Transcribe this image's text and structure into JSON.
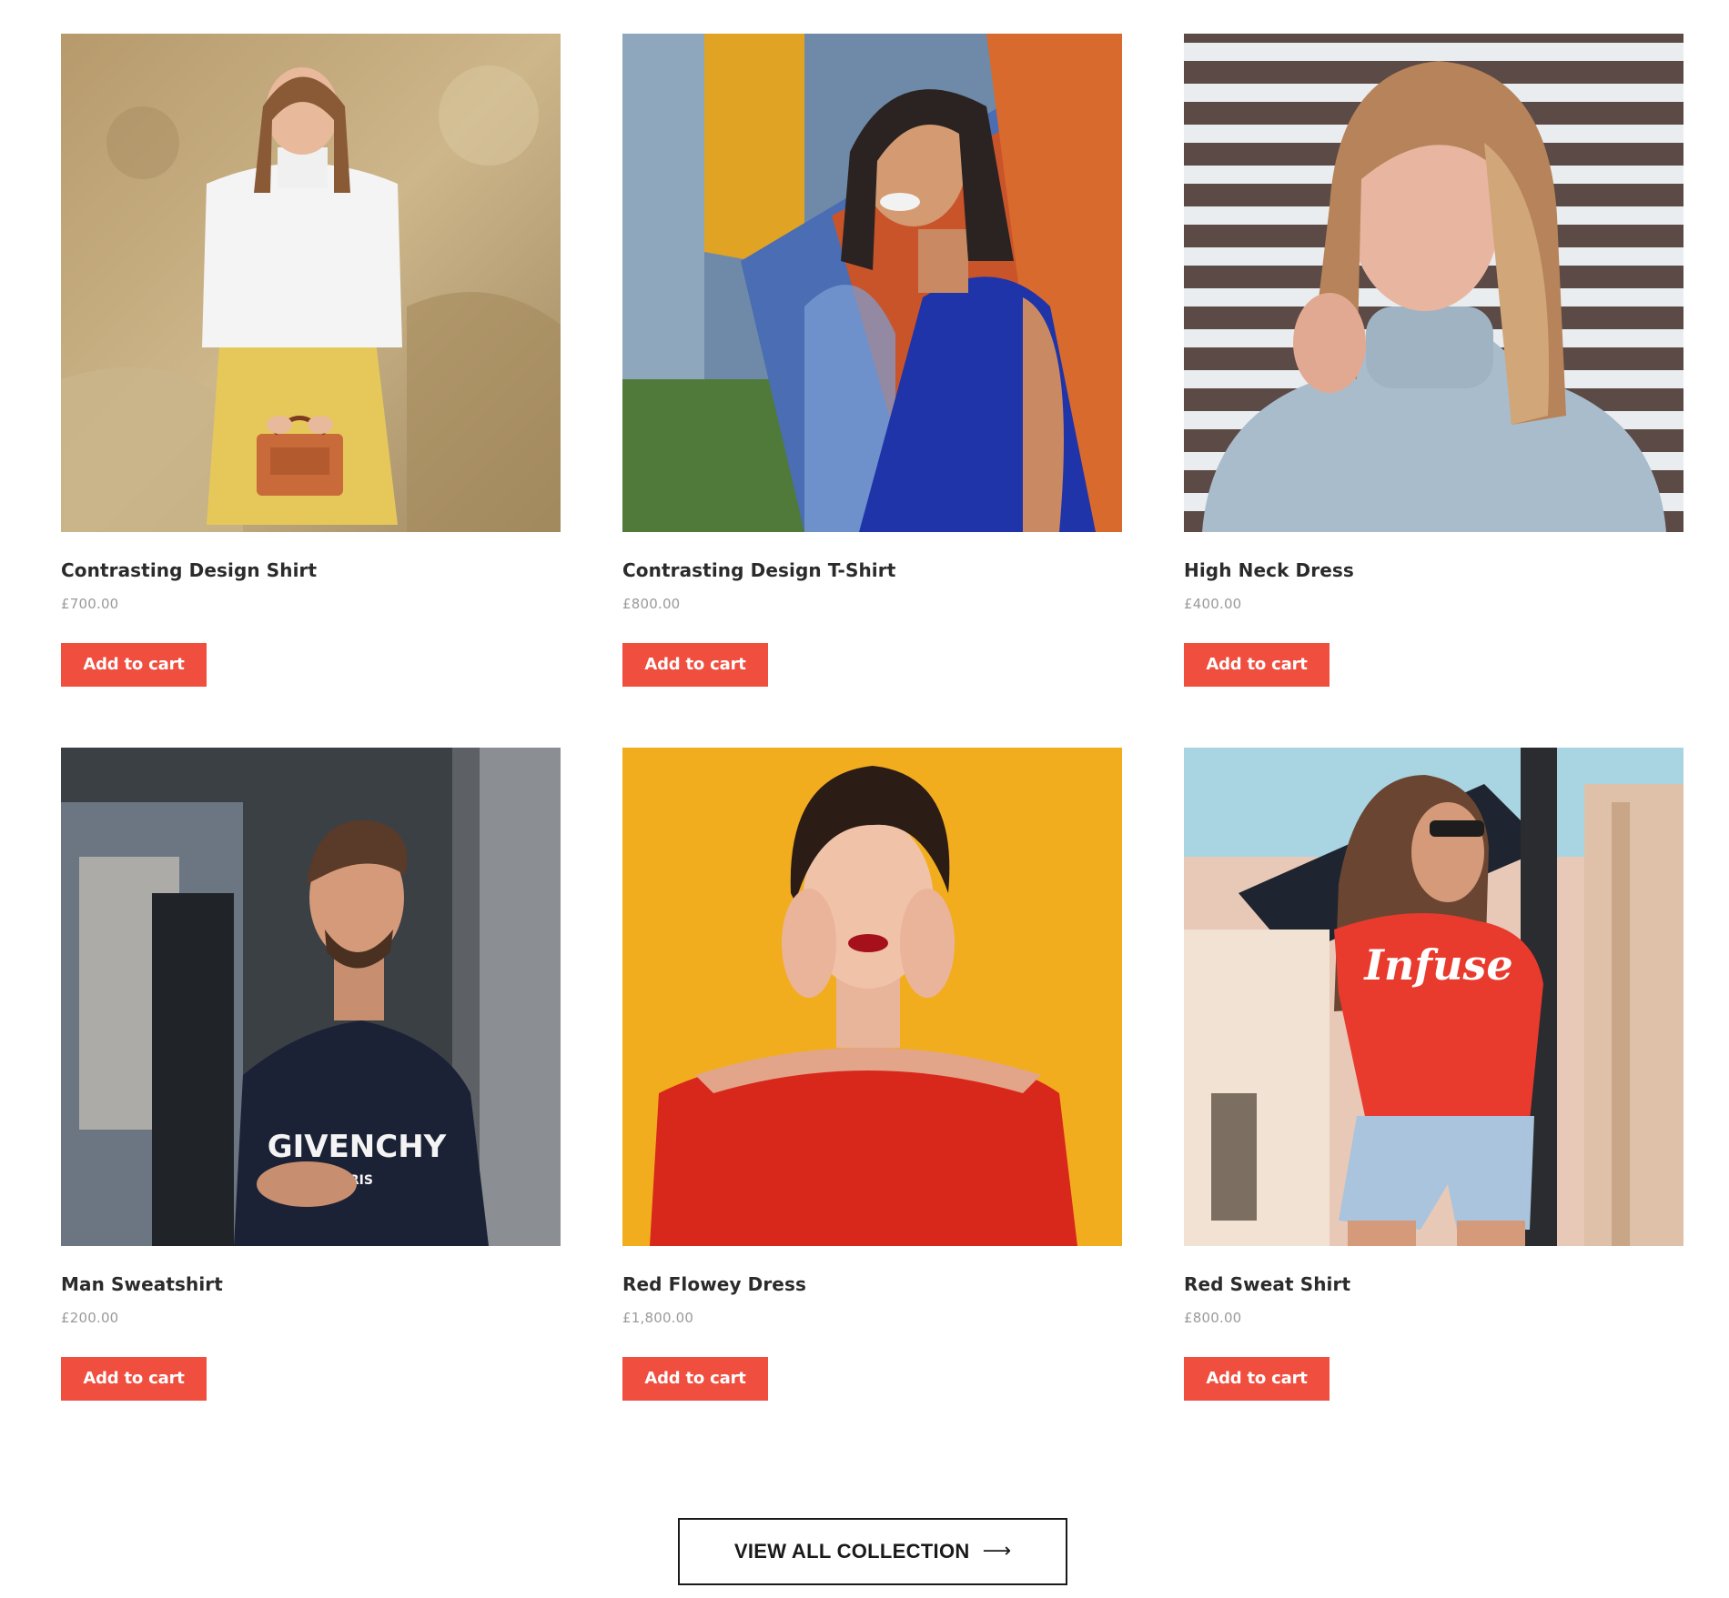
{
  "colors": {
    "accent": "#f04e3e",
    "title_text": "#2b2b2b",
    "price_text": "#9a9a9a",
    "border": "#1a1a1a"
  },
  "products": [
    {
      "name": "Contrasting Design Shirt",
      "price": "£700.00",
      "button_label": "Add to cart",
      "image": "woman in white sweater and yellow skirt holding orange handbag against rocky hillside"
    },
    {
      "name": "Contrasting Design T-Shirt",
      "price": "£800.00",
      "button_label": "Add to cart",
      "image": "smiling woman in blue sleeveless top leaning on colorful graffiti wall"
    },
    {
      "name": "High Neck Dress",
      "price": "£400.00",
      "button_label": "Add to cart",
      "image": "woman in light blue turtleneck sweater in front of striped shutters"
    },
    {
      "name": "Man Sweatshirt",
      "price": "£200.00",
      "button_label": "Add to cart",
      "image": "man in black Givenchy sweatshirt on city street"
    },
    {
      "name": "Red Flowey Dress",
      "price": "£1,800.00",
      "button_label": "Add to cart",
      "image": "woman in red off-shoulder top against yellow background"
    },
    {
      "name": "Red Sweat Shirt",
      "price": "£800.00",
      "button_label": "Add to cart",
      "image": "woman in red Infuse t-shirt and denim shorts on sunny street"
    }
  ],
  "view_all": {
    "label": "VIEW ALL COLLECTION",
    "icon": "arrow-right-icon"
  }
}
